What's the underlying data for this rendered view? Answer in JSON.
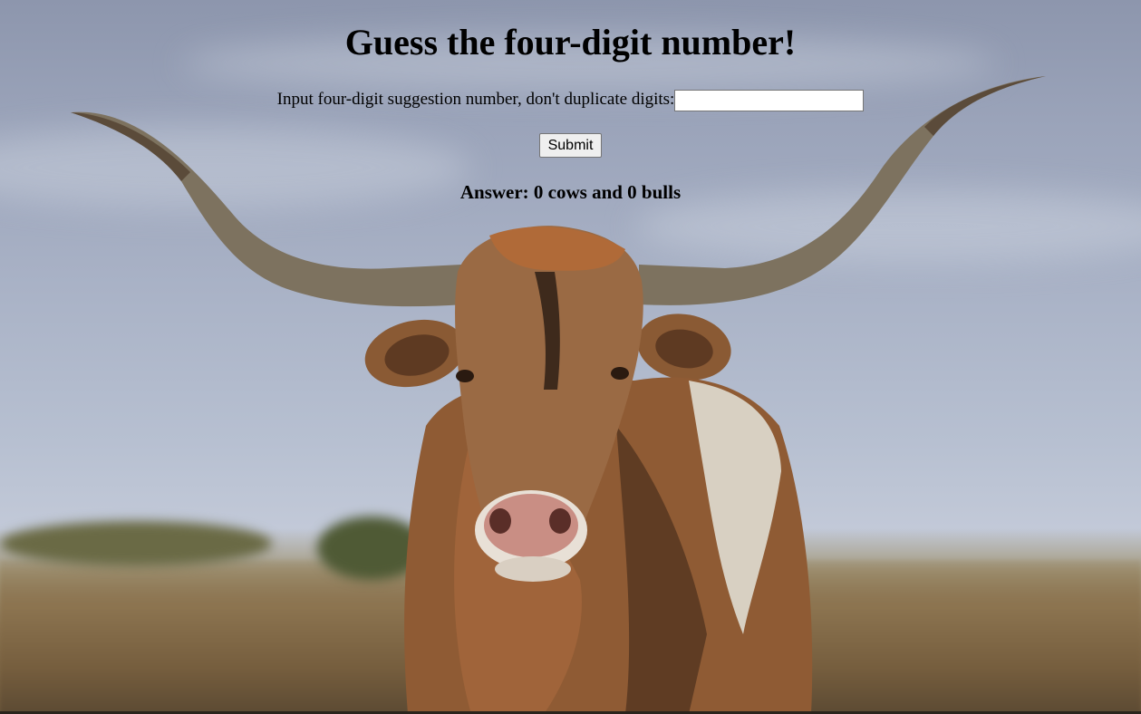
{
  "page": {
    "title": "Guess the four-digit number!",
    "input_label": "Input four-digit suggestion number, don't duplicate digits:",
    "input_value": "",
    "input_placeholder": "",
    "submit_label": "Submit",
    "answer_text": "Answer: 0 cows and 0 bulls"
  },
  "background": {
    "subject": "longhorn-bull-photo",
    "sky_color": "#a9b2c6",
    "field_color": "#8a7350"
  }
}
